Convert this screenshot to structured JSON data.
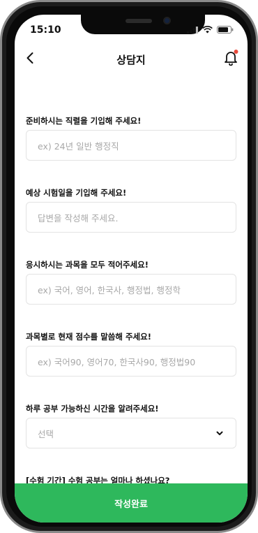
{
  "status": {
    "time": "15:10"
  },
  "header": {
    "title": "상담지"
  },
  "questions": [
    {
      "label": "준비하시는 직렬을 기입해 주세요!",
      "placeholder": "ex) 24년 일반 행정직"
    },
    {
      "label": "예상 시험일을 기입해 주세요!",
      "placeholder": "답변을 작성해 주세요."
    },
    {
      "label": "응시하시는 과목을 모두 적어주세요!",
      "placeholder": "ex) 국어, 영어, 한국사, 행정법, 행정학"
    },
    {
      "label": "과목별로 현재 점수를 말씀해 주세요!",
      "placeholder": "ex) 국어90, 영어70, 한국사90, 행정법90"
    },
    {
      "label": "하루 공부 가능하신 시간을 알려주세요!",
      "placeholder": "선택"
    },
    {
      "label": "[수험 기간] 수험 공부는 얼마나 하셨나요?",
      "placeholder": ""
    }
  ],
  "submit": {
    "label": "작성완료"
  },
  "colors": {
    "accent": "#2eb85c",
    "notification_dot": "#e84a3b"
  },
  "icons": [
    "back-arrow-icon",
    "bell-icon",
    "signal-icon",
    "wifi-icon",
    "battery-icon",
    "chevron-down-icon"
  ]
}
